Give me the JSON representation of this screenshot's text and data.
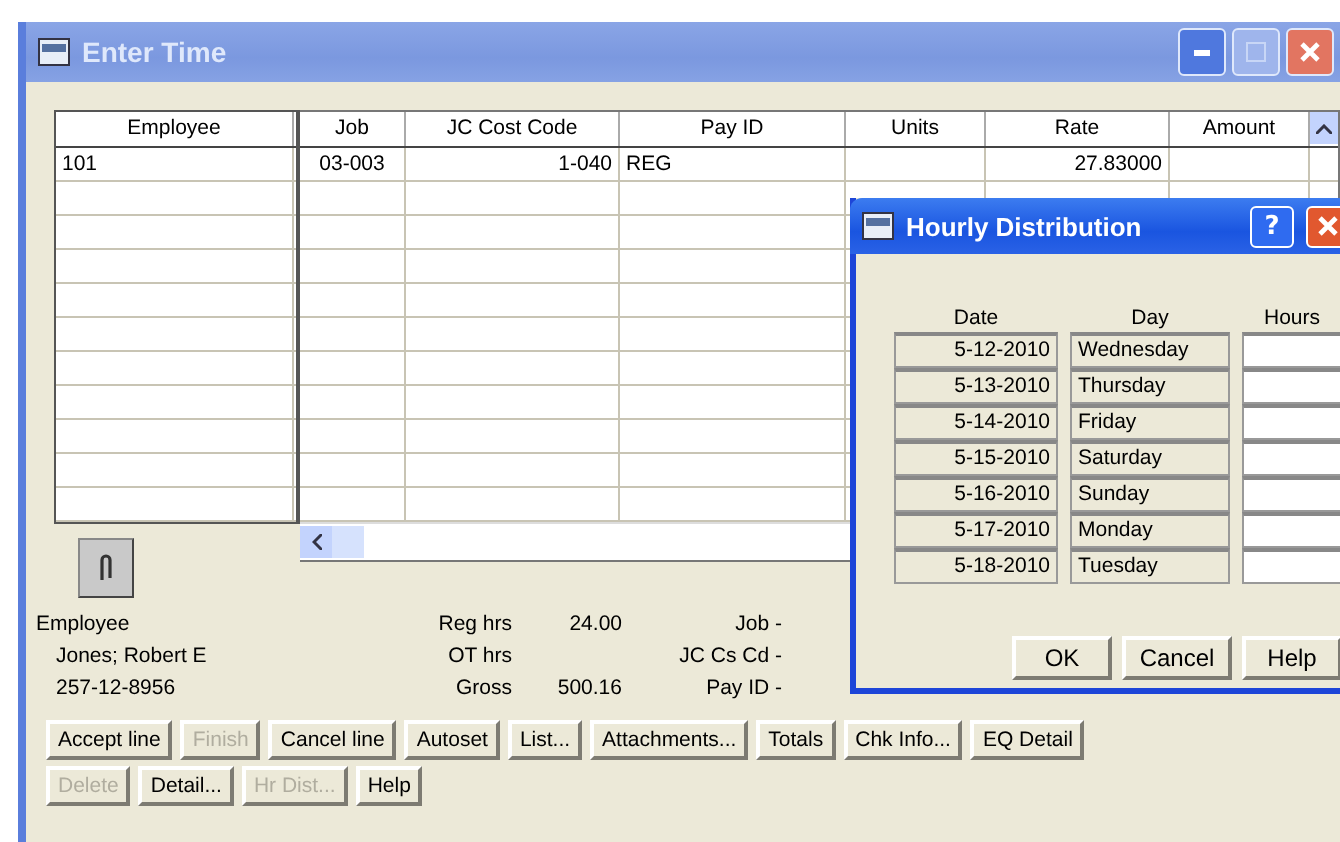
{
  "window": {
    "title": "Enter Time"
  },
  "grid": {
    "columns": [
      "Employee",
      "Job",
      "JC Cost Code",
      "Pay ID",
      "Units",
      "Rate",
      "Amount"
    ],
    "rows": [
      {
        "employee": "101",
        "job": "03-003",
        "jc_cost_code": "1-040",
        "pay_id": "REG",
        "rate": "27.83000"
      }
    ]
  },
  "summary": {
    "employee_label": "Employee",
    "employee_name": "Jones; Robert E",
    "employee_id": "257-12-8956",
    "totals": [
      {
        "label": "Reg hrs",
        "value": "24.00"
      },
      {
        "label": "OT hrs"
      },
      {
        "label": "Gross",
        "value": "500.16"
      }
    ],
    "line_info": [
      {
        "label": "Job -"
      },
      {
        "label": "JC Cs Cd -"
      },
      {
        "label": "Pay ID -"
      }
    ]
  },
  "button_rows": [
    [
      {
        "label": "Accept line",
        "disabled": false
      },
      {
        "label": "Finish",
        "disabled": true
      },
      {
        "label": "Cancel line",
        "disabled": false
      },
      {
        "label": "Autoset",
        "disabled": false
      },
      {
        "label": "List...",
        "disabled": false
      },
      {
        "label": "Attachments...",
        "disabled": false
      },
      {
        "label": "Totals",
        "disabled": false
      },
      {
        "label": "Chk Info...",
        "disabled": false
      },
      {
        "label": "EQ Detail",
        "disabled": false
      }
    ],
    [
      {
        "label": "Delete",
        "disabled": true
      },
      {
        "label": "Detail...",
        "disabled": false
      },
      {
        "label": "Hr Dist...",
        "disabled": true
      },
      {
        "label": "Help",
        "disabled": false
      }
    ]
  ],
  "dialog": {
    "title": "Hourly Distribution",
    "help_button": "?",
    "columns": [
      "Date",
      "Day",
      "Hours"
    ],
    "rows": [
      {
        "date": "5-12-2010",
        "day": "Wednesday"
      },
      {
        "date": "5-13-2010",
        "day": "Thursday"
      },
      {
        "date": "5-14-2010",
        "day": "Friday"
      },
      {
        "date": "5-15-2010",
        "day": "Saturday"
      },
      {
        "date": "5-16-2010",
        "day": "Sunday"
      },
      {
        "date": "5-17-2010",
        "day": "Monday"
      },
      {
        "date": "5-18-2010",
        "day": "Tuesday"
      }
    ],
    "buttons": [
      "OK",
      "Cancel",
      "Help"
    ]
  }
}
